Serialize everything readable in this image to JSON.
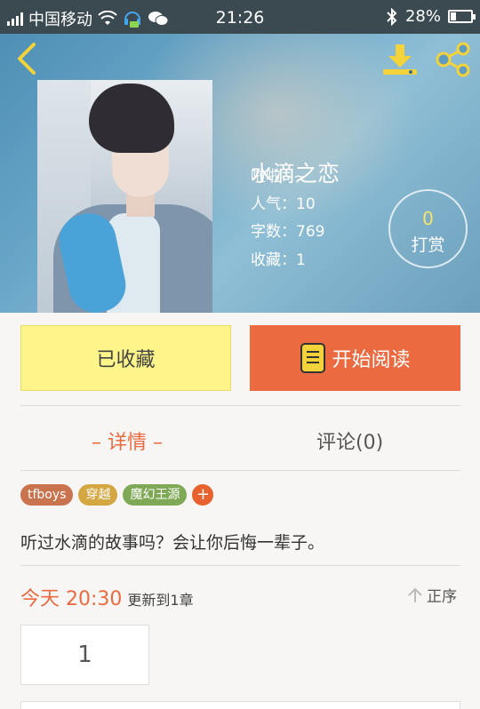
{
  "status_bar": {
    "carrier": "中国移动",
    "time": "21:26",
    "battery": "28%",
    "battery_level": 0.28
  },
  "book": {
    "title": "水滴之恋",
    "author": "啦啦~~",
    "popularity": "人气：10",
    "word_count": "字数：769",
    "favorites": "收藏：1"
  },
  "reward": {
    "count": "0",
    "label": "打赏"
  },
  "actions": {
    "favorited_label": "已收藏",
    "read_label": "开始阅读"
  },
  "tabs": {
    "detail": "– 详情 –",
    "comments": "评论(0)"
  },
  "tags": [
    {
      "label": "tfboys",
      "color": "#c9744e"
    },
    {
      "label": "穿越",
      "color": "#d4a743"
    },
    {
      "label": "魔幻王源",
      "color": "#7fa957"
    }
  ],
  "tag_add": "+",
  "description": "听过水滴的故事吗？会让你后悔一辈子。",
  "update": {
    "day_time": "今天 20:30",
    "text": "更新到1章"
  },
  "sort_label": "正序",
  "chapters": [
    "1"
  ],
  "icons": {
    "back": "chevron-left-icon",
    "download": "download-icon",
    "share": "share-icon",
    "book": "book-icon",
    "sort": "arrow-up-icon"
  },
  "colors": {
    "accent": "#ec6a3f",
    "favorite_bg": "#fdf58a",
    "icon_yellow": "#f4d23a"
  }
}
